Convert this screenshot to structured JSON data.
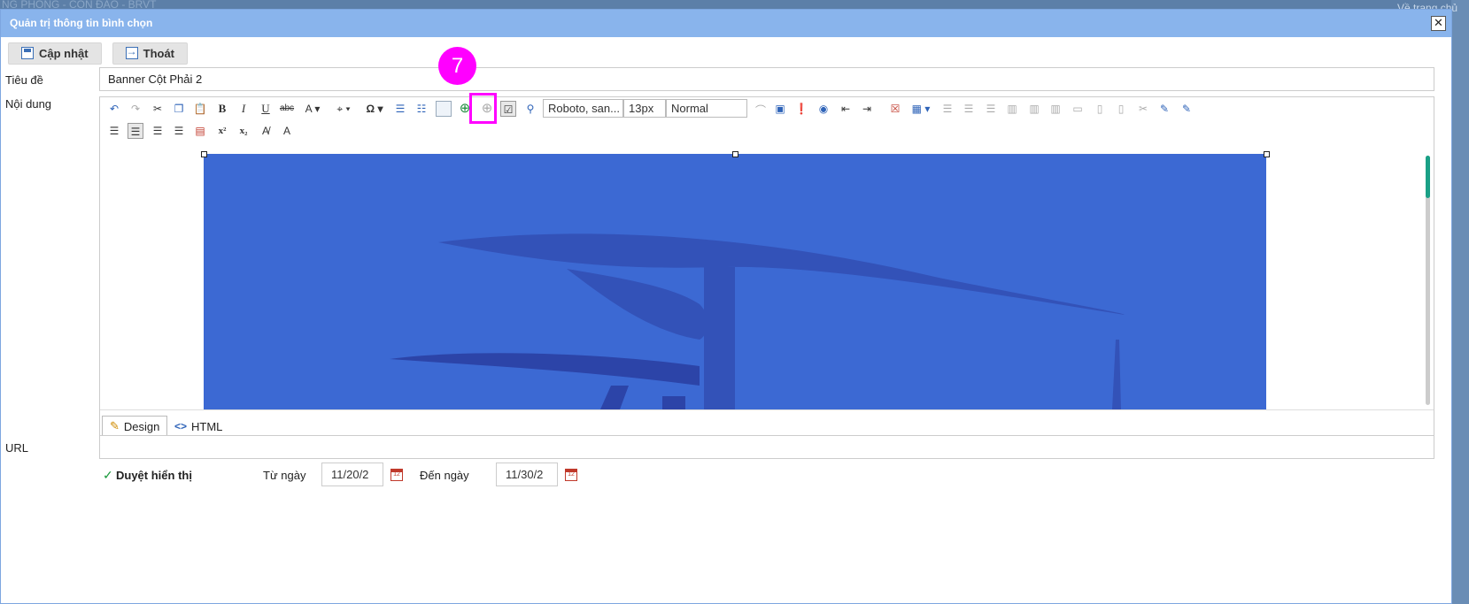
{
  "background": {
    "top_text": "NG PHONG - CÔN ĐẢO - BRVT",
    "right_link": "Về trang chủ"
  },
  "dialog": {
    "title": "Quản trị thông tin bình chọn",
    "close_symbol": "✕"
  },
  "toolbar": {
    "update_label": "Cập nhật",
    "exit_label": "Thoát"
  },
  "form": {
    "title_label": "Tiêu đề",
    "title_value": "Banner Cột Phải 2",
    "content_label": "Nội dung",
    "url_label": "URL",
    "url_value": "",
    "approve_label": "Duyệt hiển thị",
    "from_label": "Từ ngày",
    "from_value": "11/20/2",
    "to_label": "Đến ngày",
    "to_value": "11/30/2",
    "calendar_glyph": "12"
  },
  "editor": {
    "font_name": "Roboto, san...",
    "font_size": "13px",
    "format": "Normal",
    "mode_design": "Design",
    "mode_html": "HTML"
  },
  "annotation": {
    "step_number": "7",
    "color": "#ff00ff"
  },
  "colors": {
    "titlebar": "#89b4ec",
    "image_fill": "#3c69d3",
    "image_dark": "#2c44a8"
  }
}
